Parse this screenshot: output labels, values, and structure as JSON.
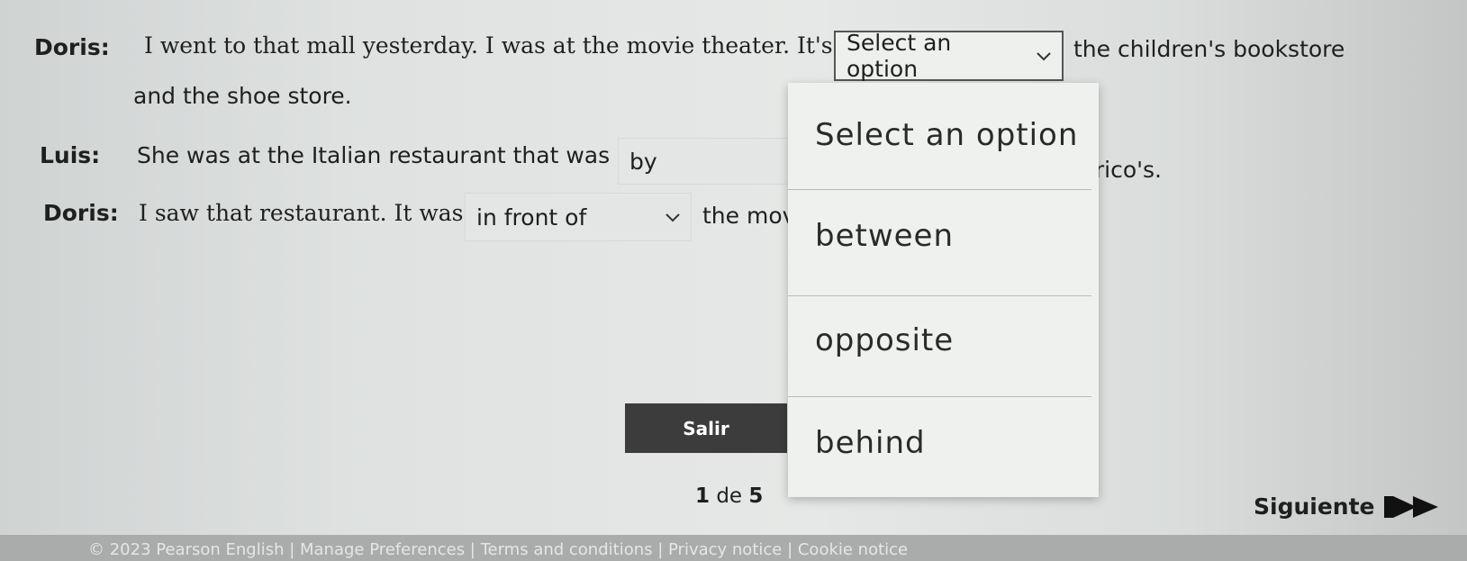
{
  "dialogue": [
    {
      "speaker": "Doris:",
      "text_before": "I went to that mall yesterday. I was at the movie theater. It's",
      "select_value": "Select an option",
      "text_after": "the children's bookstore",
      "continuation": "and the shoe store."
    },
    {
      "speaker": "Luis:",
      "text_before": "She was at the Italian restaurant that was",
      "select_value": "by",
      "text_after": "nrico's."
    },
    {
      "speaker": "Doris:",
      "text_before": "I saw that restaurant. It was",
      "select_value": "in front of",
      "text_after": "the mov"
    }
  ],
  "dropdown": {
    "header": "Select an option",
    "options": [
      "between",
      "opposite",
      "behind"
    ]
  },
  "exit_button": "Salir",
  "pagination": {
    "current": "1",
    "separator": "de",
    "total": "5"
  },
  "next_button": "Siguiente",
  "footer": "© 2023 Pearson English  |  Manage Preferences  |  Terms and conditions  |  Privacy notice  |  Cookie notice"
}
